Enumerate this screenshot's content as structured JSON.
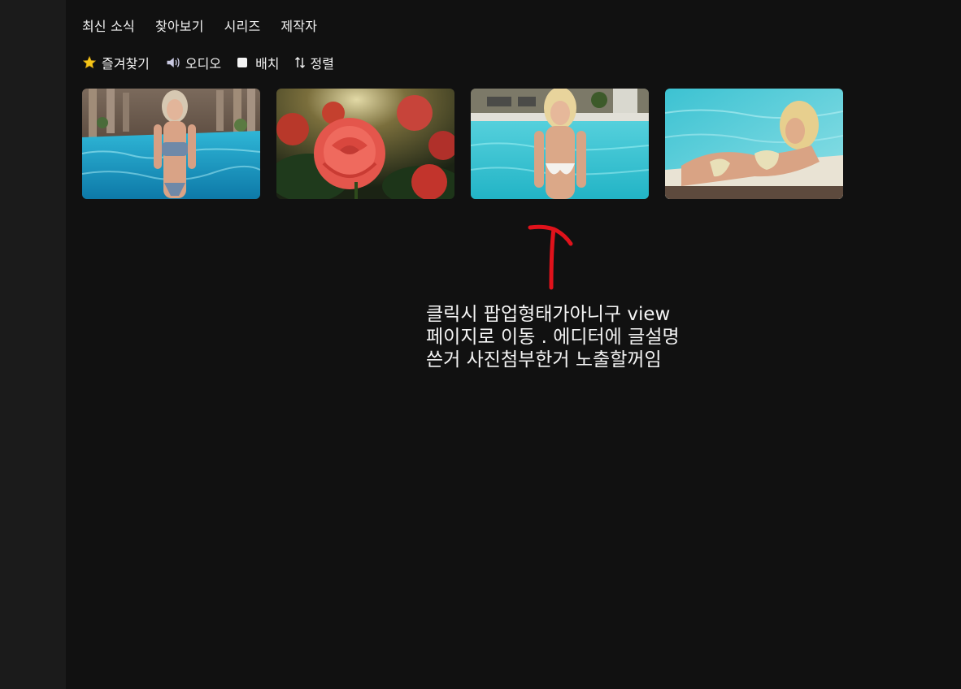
{
  "nav": {
    "items": [
      {
        "label": "최신 소식"
      },
      {
        "label": "찾아보기"
      },
      {
        "label": "시리즈"
      },
      {
        "label": "제작자"
      }
    ]
  },
  "toolbar": {
    "favorites": {
      "label": "즐겨찾기",
      "icon": "star-icon",
      "color": "#f5c518"
    },
    "audio": {
      "label": "오디오",
      "icon": "speaker-icon"
    },
    "batch": {
      "label": "배치",
      "icon": "checkbox-icon"
    },
    "sort": {
      "label": "정렬",
      "icon": "sort-arrows-icon"
    }
  },
  "gallery": {
    "items": [
      {
        "description": "woman in blue bikini standing in pool with columns"
      },
      {
        "description": "red roses close-up"
      },
      {
        "description": "blonde woman in white bikini by pool"
      },
      {
        "description": "blonde woman in floral bikini lying poolside"
      }
    ]
  },
  "annotation": {
    "lines": [
      "클릭시 팝업형태가아니구 view",
      "페이지로 이동 . 에디터에 글설명",
      "쓴거 사진첨부한거 노출할꺼임"
    ],
    "arrow_color": "#e0121b"
  }
}
